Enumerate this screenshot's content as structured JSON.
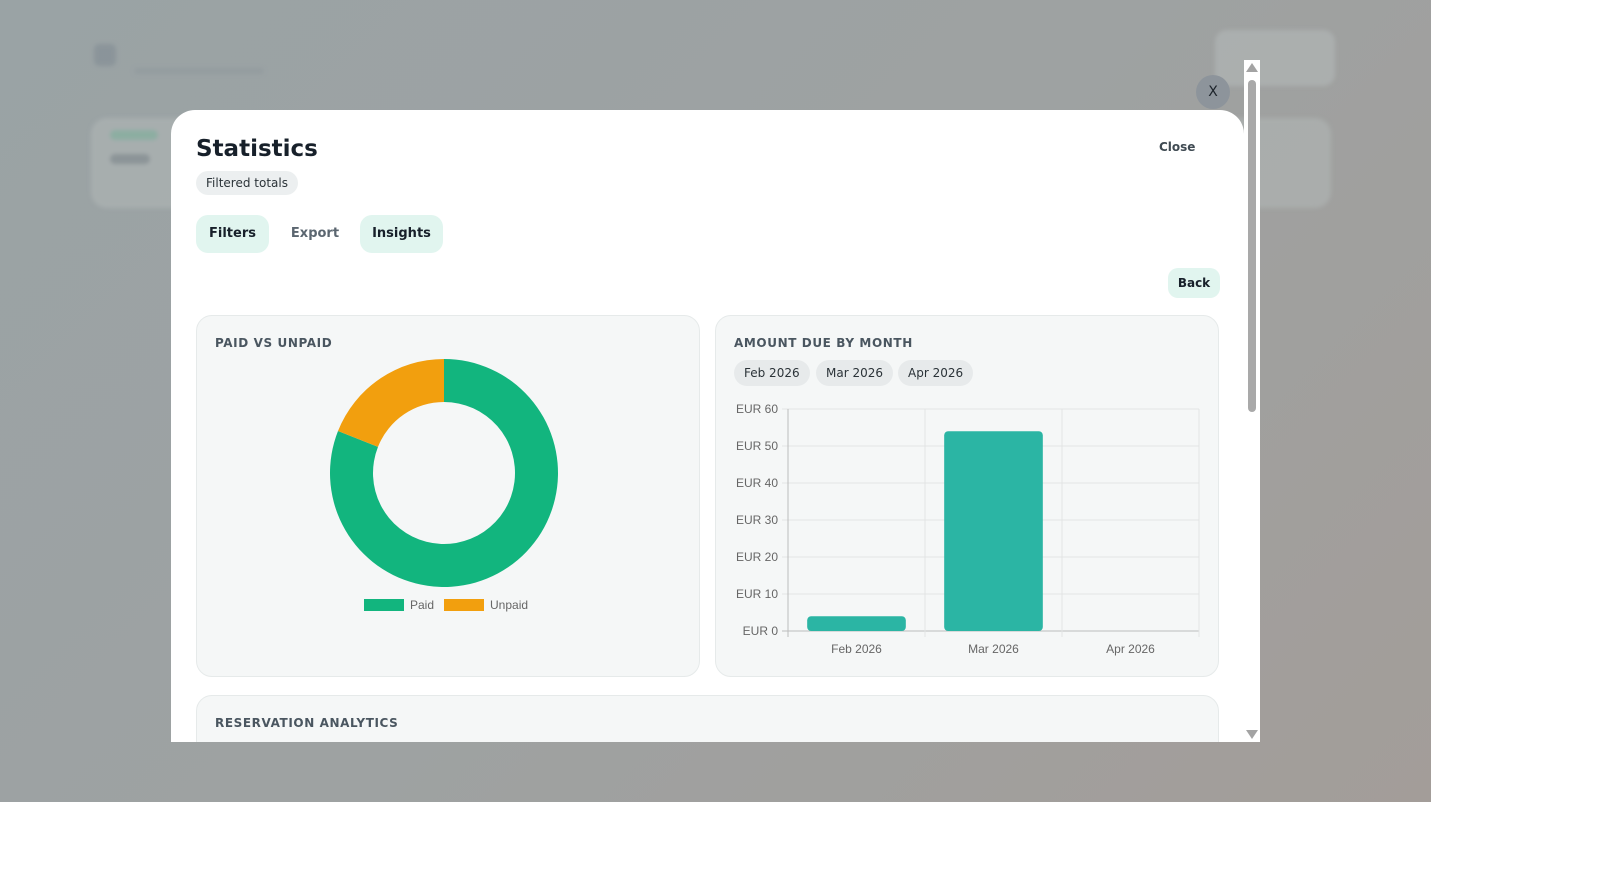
{
  "colors": {
    "paid": "#12b57e",
    "unpaid": "#f29f0e",
    "bar": "#2bb5a4",
    "accent_bg": "#e1f5ef"
  },
  "modal": {
    "title": "Statistics",
    "badge": "Filtered totals",
    "close_label": "Close",
    "tabs": [
      "Filters",
      "Export",
      "Insights"
    ],
    "back_label": "Back",
    "dismiss_label": "X"
  },
  "paid_card": {
    "label": "PAID VS UNPAID"
  },
  "amount_card": {
    "label": "AMOUNT DUE BY MONTH",
    "month_chips": [
      "Feb 2026",
      "Mar 2026",
      "Apr 2026"
    ]
  },
  "analytics_card": {
    "label": "RESERVATION ANALYTICS"
  },
  "chart_data": [
    {
      "type": "pie",
      "style": "donut",
      "categories": [
        "Paid",
        "Unpaid"
      ],
      "values": [
        81,
        19
      ],
      "legend": [
        "Paid",
        "Unpaid"
      ],
      "legend_position": "bottom"
    },
    {
      "type": "bar",
      "categories": [
        "Feb 2026",
        "Mar 2026",
        "Apr 2026"
      ],
      "values": [
        4,
        54,
        0
      ],
      "ylim": [
        0,
        60
      ],
      "yticks": [
        "EUR 0",
        "EUR 10",
        "EUR 20",
        "EUR 30",
        "EUR 40",
        "EUR 50",
        "EUR 60"
      ],
      "grid": true
    }
  ]
}
